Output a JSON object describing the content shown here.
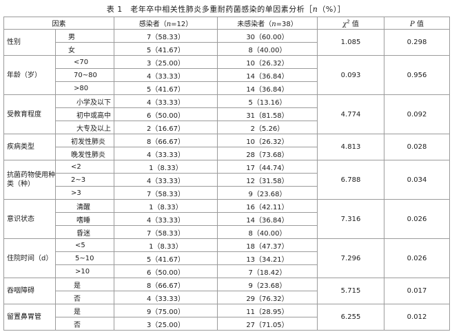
{
  "caption": {
    "prefix": "表 1　老年卒中相关性肺炎多重耐药菌感染的单因素分析［",
    "n_symbol": "n",
    "suffix": "（%）］"
  },
  "headers": {
    "factor": "因素",
    "infected_pre": "感染者（",
    "infected_n": "n",
    "infected_post": "=12）",
    "uninfected_pre": "未感染者（",
    "uninfected_n": "n",
    "uninfected_post": "=38）",
    "chi_symbol": "χ",
    "chi_sup": "2",
    "chi_post": " 值",
    "p_symbol": "P",
    "p_post": " 值"
  },
  "groups": [
    {
      "factor": "性别",
      "chi2": "1.085",
      "p": "0.298",
      "rows": [
        {
          "level": "男",
          "a": "7（58.33）",
          "b": "30（60.00）"
        },
        {
          "level": "女",
          "a": "5（41.67）",
          "b": "8（40.00）"
        }
      ]
    },
    {
      "factor": "年龄（岁）",
      "chi2": "0.093",
      "p": "0.956",
      "rows": [
        {
          "level": "<70",
          "a": "3（25.00）",
          "b": "10（26.32）"
        },
        {
          "level": "70~80",
          "a": "4（33.33）",
          "b": "14（36.84）"
        },
        {
          "level": ">80",
          "a": "5（41.67）",
          "b": "14（36.84）"
        }
      ]
    },
    {
      "factor": "受教育程度",
      "chi2": "4.774",
      "p": "0.092",
      "rows": [
        {
          "level": "小学及以下",
          "a": "4（33.33）",
          "b": "5（13.16）"
        },
        {
          "level": "初中或高中",
          "a": "6（50.00）",
          "b": "31（81.58）"
        },
        {
          "level": "大专及以上",
          "a": "2（16.67）",
          "b": "2（5.26）"
        }
      ]
    },
    {
      "factor": "疾病类型",
      "chi2": "4.813",
      "p": "0.028",
      "rows": [
        {
          "level": "初发性肺炎",
          "a": "8（66.67）",
          "b": "10（26.32）"
        },
        {
          "level": "晚发性肺炎",
          "a": "4（33.33）",
          "b": "28（73.68）"
        }
      ]
    },
    {
      "factor": "抗菌药物使用种类（种）",
      "chi2": "6.788",
      "p": "0.034",
      "rows": [
        {
          "level": "<2",
          "a": "1（8.33）",
          "b": "17（44.74）"
        },
        {
          "level": "2~3",
          "a": "4（33.33）",
          "b": "12（31.58）"
        },
        {
          "level": ">3",
          "a": "7（58.33）",
          "b": "9（23.68）"
        }
      ]
    },
    {
      "factor": "意识状态",
      "chi2": "7.316",
      "p": "0.026",
      "rows": [
        {
          "level": "清醒",
          "a": "1（8.33）",
          "b": "16（42.11）"
        },
        {
          "level": "嗜睡",
          "a": "4（33.33）",
          "b": "14（36.84）"
        },
        {
          "level": "昏迷",
          "a": "7（58.33）",
          "b": "8（40.00）"
        }
      ]
    },
    {
      "factor": "住院时间（d）",
      "chi2": "7.296",
      "p": "0.026",
      "rows": [
        {
          "level": "<5",
          "a": "1（8.33）",
          "b": "18（47.37）"
        },
        {
          "level": "5~10",
          "a": "5（41.67）",
          "b": "13（34.21）"
        },
        {
          "level": ">10",
          "a": "6（50.00）",
          "b": "7（18.42）"
        }
      ]
    },
    {
      "factor": "吞咽障碍",
      "chi2": "5.715",
      "p": "0.017",
      "rows": [
        {
          "level": "是",
          "a": "8（66.67）",
          "b": "9（23.68）"
        },
        {
          "level": "否",
          "a": "4（33.33）",
          "b": "29（76.32）"
        }
      ]
    },
    {
      "factor": "留置鼻胃管",
      "chi2": "6.255",
      "p": "0.012",
      "rows": [
        {
          "level": "是",
          "a": "9（75.00）",
          "b": "11（28.95）"
        },
        {
          "level": "否",
          "a": "3（25.00）",
          "b": "27（71.05）"
        }
      ]
    }
  ]
}
